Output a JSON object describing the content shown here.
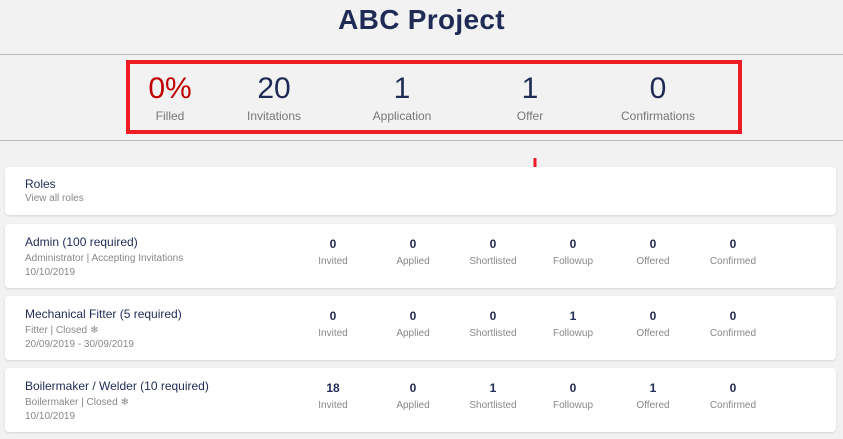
{
  "project_title": "ABC Project",
  "stats": [
    {
      "value": "0%",
      "label": "Filled"
    },
    {
      "value": "20",
      "label": "Invitations"
    },
    {
      "value": "1",
      "label": "Application"
    },
    {
      "value": "1",
      "label": "Offer"
    },
    {
      "value": "0",
      "label": "Confirmations"
    }
  ],
  "roles_header": {
    "title": "Roles",
    "link": "View all roles"
  },
  "metric_labels": [
    "Invited",
    "Applied",
    "Shortlisted",
    "Followup",
    "Offered",
    "Confirmed"
  ],
  "jobs": [
    {
      "name": "Admin (100 required)",
      "meta": "Administrator | Accepting Invitations",
      "snow": "",
      "date": "10/10/2019",
      "values": [
        "0",
        "0",
        "0",
        "0",
        "0",
        "0"
      ]
    },
    {
      "name": "Mechanical Fitter (5 required)",
      "meta": "Fitter | Closed",
      "snow": "❄",
      "date": "20/09/2019 - 30/09/2019",
      "values": [
        "0",
        "0",
        "0",
        "1",
        "0",
        "0"
      ]
    },
    {
      "name": "Boilermaker / Welder (10 required)",
      "meta": "Boilermaker | Closed",
      "snow": "❄",
      "date": "10/10/2019",
      "values": [
        "18",
        "0",
        "1",
        "0",
        "1",
        "0"
      ]
    }
  ],
  "colors": {
    "title": "#1f2a55",
    "highlight": "#ee1c25",
    "filled": "#c00000"
  }
}
